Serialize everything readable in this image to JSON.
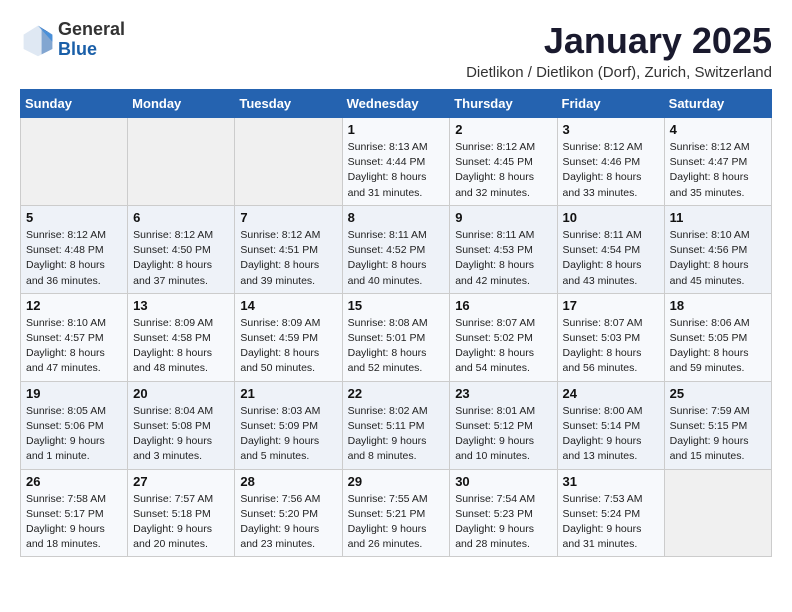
{
  "logo": {
    "general": "General",
    "blue": "Blue"
  },
  "title": "January 2025",
  "subtitle": "Dietlikon / Dietlikon (Dorf), Zurich, Switzerland",
  "headers": [
    "Sunday",
    "Monday",
    "Tuesday",
    "Wednesday",
    "Thursday",
    "Friday",
    "Saturday"
  ],
  "weeks": [
    [
      {
        "day": "",
        "info": ""
      },
      {
        "day": "",
        "info": ""
      },
      {
        "day": "",
        "info": ""
      },
      {
        "day": "1",
        "info": "Sunrise: 8:13 AM\nSunset: 4:44 PM\nDaylight: 8 hours and 31 minutes."
      },
      {
        "day": "2",
        "info": "Sunrise: 8:12 AM\nSunset: 4:45 PM\nDaylight: 8 hours and 32 minutes."
      },
      {
        "day": "3",
        "info": "Sunrise: 8:12 AM\nSunset: 4:46 PM\nDaylight: 8 hours and 33 minutes."
      },
      {
        "day": "4",
        "info": "Sunrise: 8:12 AM\nSunset: 4:47 PM\nDaylight: 8 hours and 35 minutes."
      }
    ],
    [
      {
        "day": "5",
        "info": "Sunrise: 8:12 AM\nSunset: 4:48 PM\nDaylight: 8 hours and 36 minutes."
      },
      {
        "day": "6",
        "info": "Sunrise: 8:12 AM\nSunset: 4:50 PM\nDaylight: 8 hours and 37 minutes."
      },
      {
        "day": "7",
        "info": "Sunrise: 8:12 AM\nSunset: 4:51 PM\nDaylight: 8 hours and 39 minutes."
      },
      {
        "day": "8",
        "info": "Sunrise: 8:11 AM\nSunset: 4:52 PM\nDaylight: 8 hours and 40 minutes."
      },
      {
        "day": "9",
        "info": "Sunrise: 8:11 AM\nSunset: 4:53 PM\nDaylight: 8 hours and 42 minutes."
      },
      {
        "day": "10",
        "info": "Sunrise: 8:11 AM\nSunset: 4:54 PM\nDaylight: 8 hours and 43 minutes."
      },
      {
        "day": "11",
        "info": "Sunrise: 8:10 AM\nSunset: 4:56 PM\nDaylight: 8 hours and 45 minutes."
      }
    ],
    [
      {
        "day": "12",
        "info": "Sunrise: 8:10 AM\nSunset: 4:57 PM\nDaylight: 8 hours and 47 minutes."
      },
      {
        "day": "13",
        "info": "Sunrise: 8:09 AM\nSunset: 4:58 PM\nDaylight: 8 hours and 48 minutes."
      },
      {
        "day": "14",
        "info": "Sunrise: 8:09 AM\nSunset: 4:59 PM\nDaylight: 8 hours and 50 minutes."
      },
      {
        "day": "15",
        "info": "Sunrise: 8:08 AM\nSunset: 5:01 PM\nDaylight: 8 hours and 52 minutes."
      },
      {
        "day": "16",
        "info": "Sunrise: 8:07 AM\nSunset: 5:02 PM\nDaylight: 8 hours and 54 minutes."
      },
      {
        "day": "17",
        "info": "Sunrise: 8:07 AM\nSunset: 5:03 PM\nDaylight: 8 hours and 56 minutes."
      },
      {
        "day": "18",
        "info": "Sunrise: 8:06 AM\nSunset: 5:05 PM\nDaylight: 8 hours and 59 minutes."
      }
    ],
    [
      {
        "day": "19",
        "info": "Sunrise: 8:05 AM\nSunset: 5:06 PM\nDaylight: 9 hours and 1 minute."
      },
      {
        "day": "20",
        "info": "Sunrise: 8:04 AM\nSunset: 5:08 PM\nDaylight: 9 hours and 3 minutes."
      },
      {
        "day": "21",
        "info": "Sunrise: 8:03 AM\nSunset: 5:09 PM\nDaylight: 9 hours and 5 minutes."
      },
      {
        "day": "22",
        "info": "Sunrise: 8:02 AM\nSunset: 5:11 PM\nDaylight: 9 hours and 8 minutes."
      },
      {
        "day": "23",
        "info": "Sunrise: 8:01 AM\nSunset: 5:12 PM\nDaylight: 9 hours and 10 minutes."
      },
      {
        "day": "24",
        "info": "Sunrise: 8:00 AM\nSunset: 5:14 PM\nDaylight: 9 hours and 13 minutes."
      },
      {
        "day": "25",
        "info": "Sunrise: 7:59 AM\nSunset: 5:15 PM\nDaylight: 9 hours and 15 minutes."
      }
    ],
    [
      {
        "day": "26",
        "info": "Sunrise: 7:58 AM\nSunset: 5:17 PM\nDaylight: 9 hours and 18 minutes."
      },
      {
        "day": "27",
        "info": "Sunrise: 7:57 AM\nSunset: 5:18 PM\nDaylight: 9 hours and 20 minutes."
      },
      {
        "day": "28",
        "info": "Sunrise: 7:56 AM\nSunset: 5:20 PM\nDaylight: 9 hours and 23 minutes."
      },
      {
        "day": "29",
        "info": "Sunrise: 7:55 AM\nSunset: 5:21 PM\nDaylight: 9 hours and 26 minutes."
      },
      {
        "day": "30",
        "info": "Sunrise: 7:54 AM\nSunset: 5:23 PM\nDaylight: 9 hours and 28 minutes."
      },
      {
        "day": "31",
        "info": "Sunrise: 7:53 AM\nSunset: 5:24 PM\nDaylight: 9 hours and 31 minutes."
      },
      {
        "day": "",
        "info": ""
      }
    ]
  ]
}
